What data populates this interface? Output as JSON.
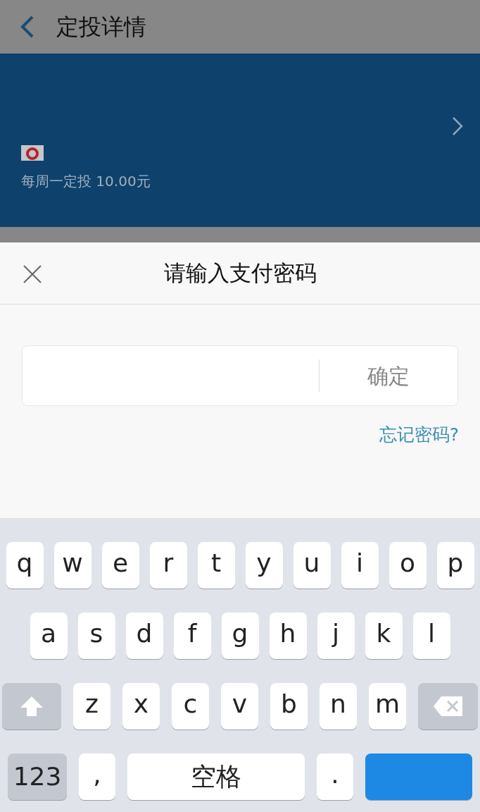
{
  "header": {
    "title": "定投详情"
  },
  "plan_card": {
    "schedule": "每周一定投 10.00元"
  },
  "password_sheet": {
    "title": "请输入支付密码",
    "confirm_button": "确定",
    "forgot_link": "忘记密码?"
  },
  "keyboard": {
    "rows": [
      {
        "keys": [
          {
            "kind": "letter",
            "label": "q"
          },
          {
            "kind": "letter",
            "label": "w"
          },
          {
            "kind": "letter",
            "label": "e"
          },
          {
            "kind": "letter",
            "label": "r"
          },
          {
            "kind": "letter",
            "label": "t"
          },
          {
            "kind": "letter",
            "label": "y"
          },
          {
            "kind": "letter",
            "label": "u"
          },
          {
            "kind": "letter",
            "label": "i"
          },
          {
            "kind": "letter",
            "label": "o"
          },
          {
            "kind": "letter",
            "label": "p"
          }
        ]
      },
      {
        "keys": [
          {
            "kind": "letter",
            "label": "a"
          },
          {
            "kind": "letter",
            "label": "s"
          },
          {
            "kind": "letter",
            "label": "d"
          },
          {
            "kind": "letter",
            "label": "f"
          },
          {
            "kind": "letter",
            "label": "g"
          },
          {
            "kind": "letter",
            "label": "h"
          },
          {
            "kind": "letter",
            "label": "j"
          },
          {
            "kind": "letter",
            "label": "k"
          },
          {
            "kind": "letter",
            "label": "l"
          }
        ]
      },
      {
        "keys": [
          {
            "kind": "shift"
          },
          {
            "kind": "letter",
            "label": "z"
          },
          {
            "kind": "letter",
            "label": "x"
          },
          {
            "kind": "letter",
            "label": "c"
          },
          {
            "kind": "letter",
            "label": "v"
          },
          {
            "kind": "letter",
            "label": "b"
          },
          {
            "kind": "letter",
            "label": "n"
          },
          {
            "kind": "letter",
            "label": "m"
          },
          {
            "kind": "delete"
          }
        ]
      },
      {
        "keys": [
          {
            "kind": "mode",
            "label": "123"
          },
          {
            "kind": "punct",
            "label": ","
          },
          {
            "kind": "space",
            "label": "空格"
          },
          {
            "kind": "punct",
            "label": "."
          },
          {
            "kind": "action"
          }
        ]
      }
    ]
  }
}
